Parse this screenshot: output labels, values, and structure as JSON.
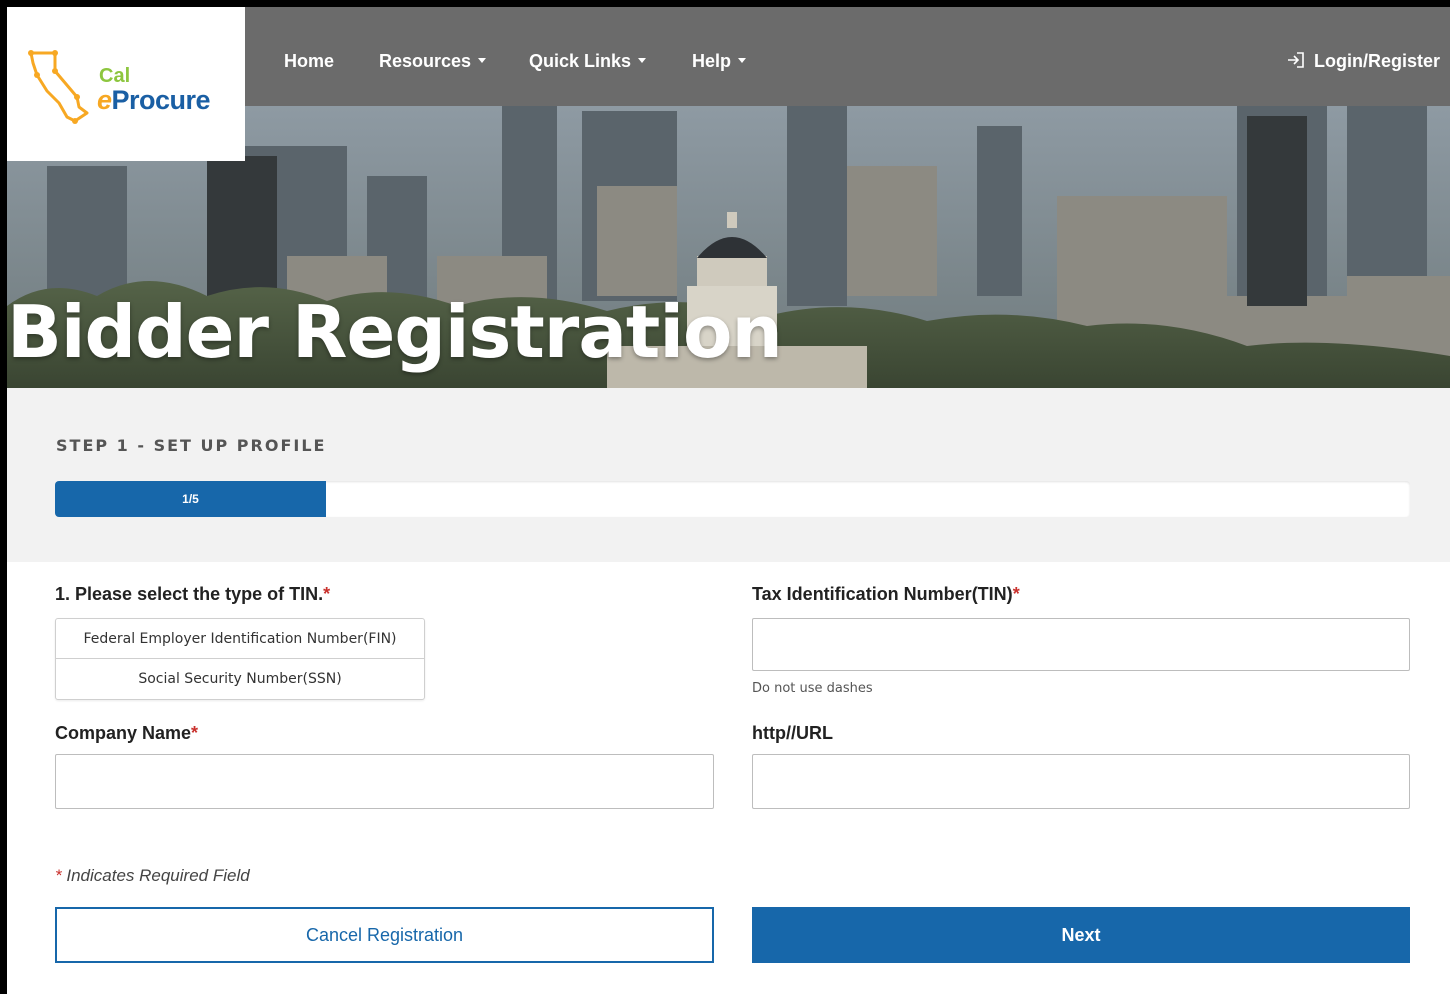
{
  "header": {
    "logo": {
      "cal": "Cal",
      "e": "e",
      "procure": "Procure"
    },
    "nav": [
      {
        "label": "Home",
        "dropdown": false
      },
      {
        "label": "Resources",
        "dropdown": true
      },
      {
        "label": "Quick Links",
        "dropdown": true
      },
      {
        "label": "Help",
        "dropdown": true
      }
    ],
    "login_label": "Login/Register"
  },
  "hero": {
    "title": "Bidder Registration"
  },
  "step": {
    "label": "STEP 1 - SET UP PROFILE",
    "progress_text": "1/5",
    "progress_fraction": 0.2
  },
  "form": {
    "tin_type_label": "1. Please select the type of TIN.",
    "tin_options": [
      "Federal Employer Identification Number(FIN)",
      "Social Security Number(SSN)"
    ],
    "tin_label": "Tax Identification Number(TIN)",
    "tin_value": "",
    "tin_help": "Do not use dashes",
    "company_label": "Company Name",
    "company_value": "",
    "url_label": "http//URL",
    "url_value": "",
    "required_star": "*",
    "required_note": "Indicates Required Field"
  },
  "actions": {
    "cancel_label": "Cancel Registration",
    "next_label": "Next"
  },
  "colors": {
    "primary": "#1767aa",
    "nav_bg": "#6b6b6b",
    "required": "#c9302c",
    "logo_green": "#8dc63f",
    "logo_orange": "#f7a823"
  }
}
